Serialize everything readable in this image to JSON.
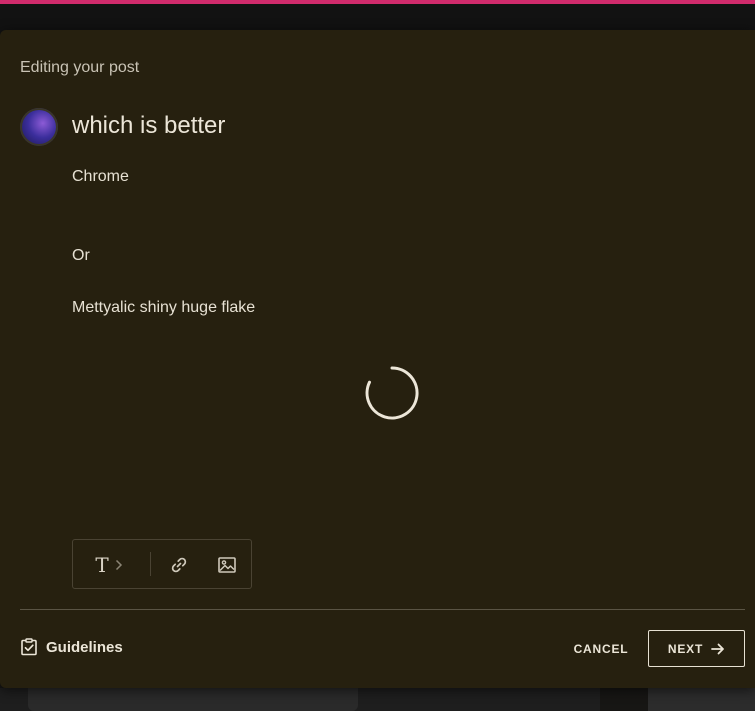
{
  "modal": {
    "heading": "Editing your post"
  },
  "post": {
    "title": "which is better",
    "body_lines": [
      "Chrome",
      "Or",
      "Mettyalic shiny huge flake"
    ]
  },
  "toolbar": {
    "text_format_glyph": "T",
    "icons": {
      "text_format": "text-format-icon",
      "expand": "chevron-right-icon",
      "link": "link-icon",
      "image": "image-icon"
    }
  },
  "footer": {
    "guidelines_label": "Guidelines",
    "cancel_label": "CANCEL",
    "next_label": "NEXT"
  },
  "colors": {
    "modal_background": "#26200f",
    "top_accent": "#d12b6c",
    "text_primary": "#ece6d8",
    "text_secondary": "#c9c3b5",
    "border": "#4a4333"
  }
}
